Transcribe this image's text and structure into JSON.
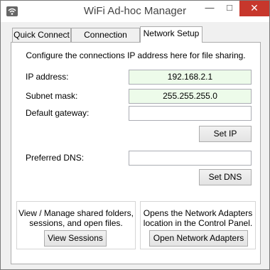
{
  "window": {
    "title": "WiFi Ad-hoc Manager",
    "icon": "wifi-icon",
    "minimize": "—",
    "maximize": "□",
    "close": "✕",
    "close_color": "#c7372c"
  },
  "tabs": [
    {
      "label": "Quick Connect",
      "active": false
    },
    {
      "label": "Connection Setup",
      "active": false
    },
    {
      "label": "Network Setup",
      "active": true
    }
  ],
  "network_setup": {
    "description": "Configure the connections IP address here for file sharing.",
    "ip_address": {
      "label": "IP address:",
      "value": "192.168.2.1"
    },
    "subnet_mask": {
      "label": "Subnet mask:",
      "value": "255.255.255.0"
    },
    "default_gateway": {
      "label": "Default gateway:",
      "value": ""
    },
    "set_ip_label": "Set IP",
    "preferred_dns": {
      "label": "Preferred DNS:",
      "value": ""
    },
    "set_dns_label": "Set DNS",
    "valid_field_color": "#edfbea"
  },
  "sessions": {
    "line1": "View / Manage shared folders,",
    "line2": "sessions, and open files.",
    "button_label": "View Sessions"
  },
  "adapters": {
    "line1": "Opens the Network Adapters",
    "line2": "location in the Control Panel.",
    "button_label": "Open Network Adapters"
  }
}
